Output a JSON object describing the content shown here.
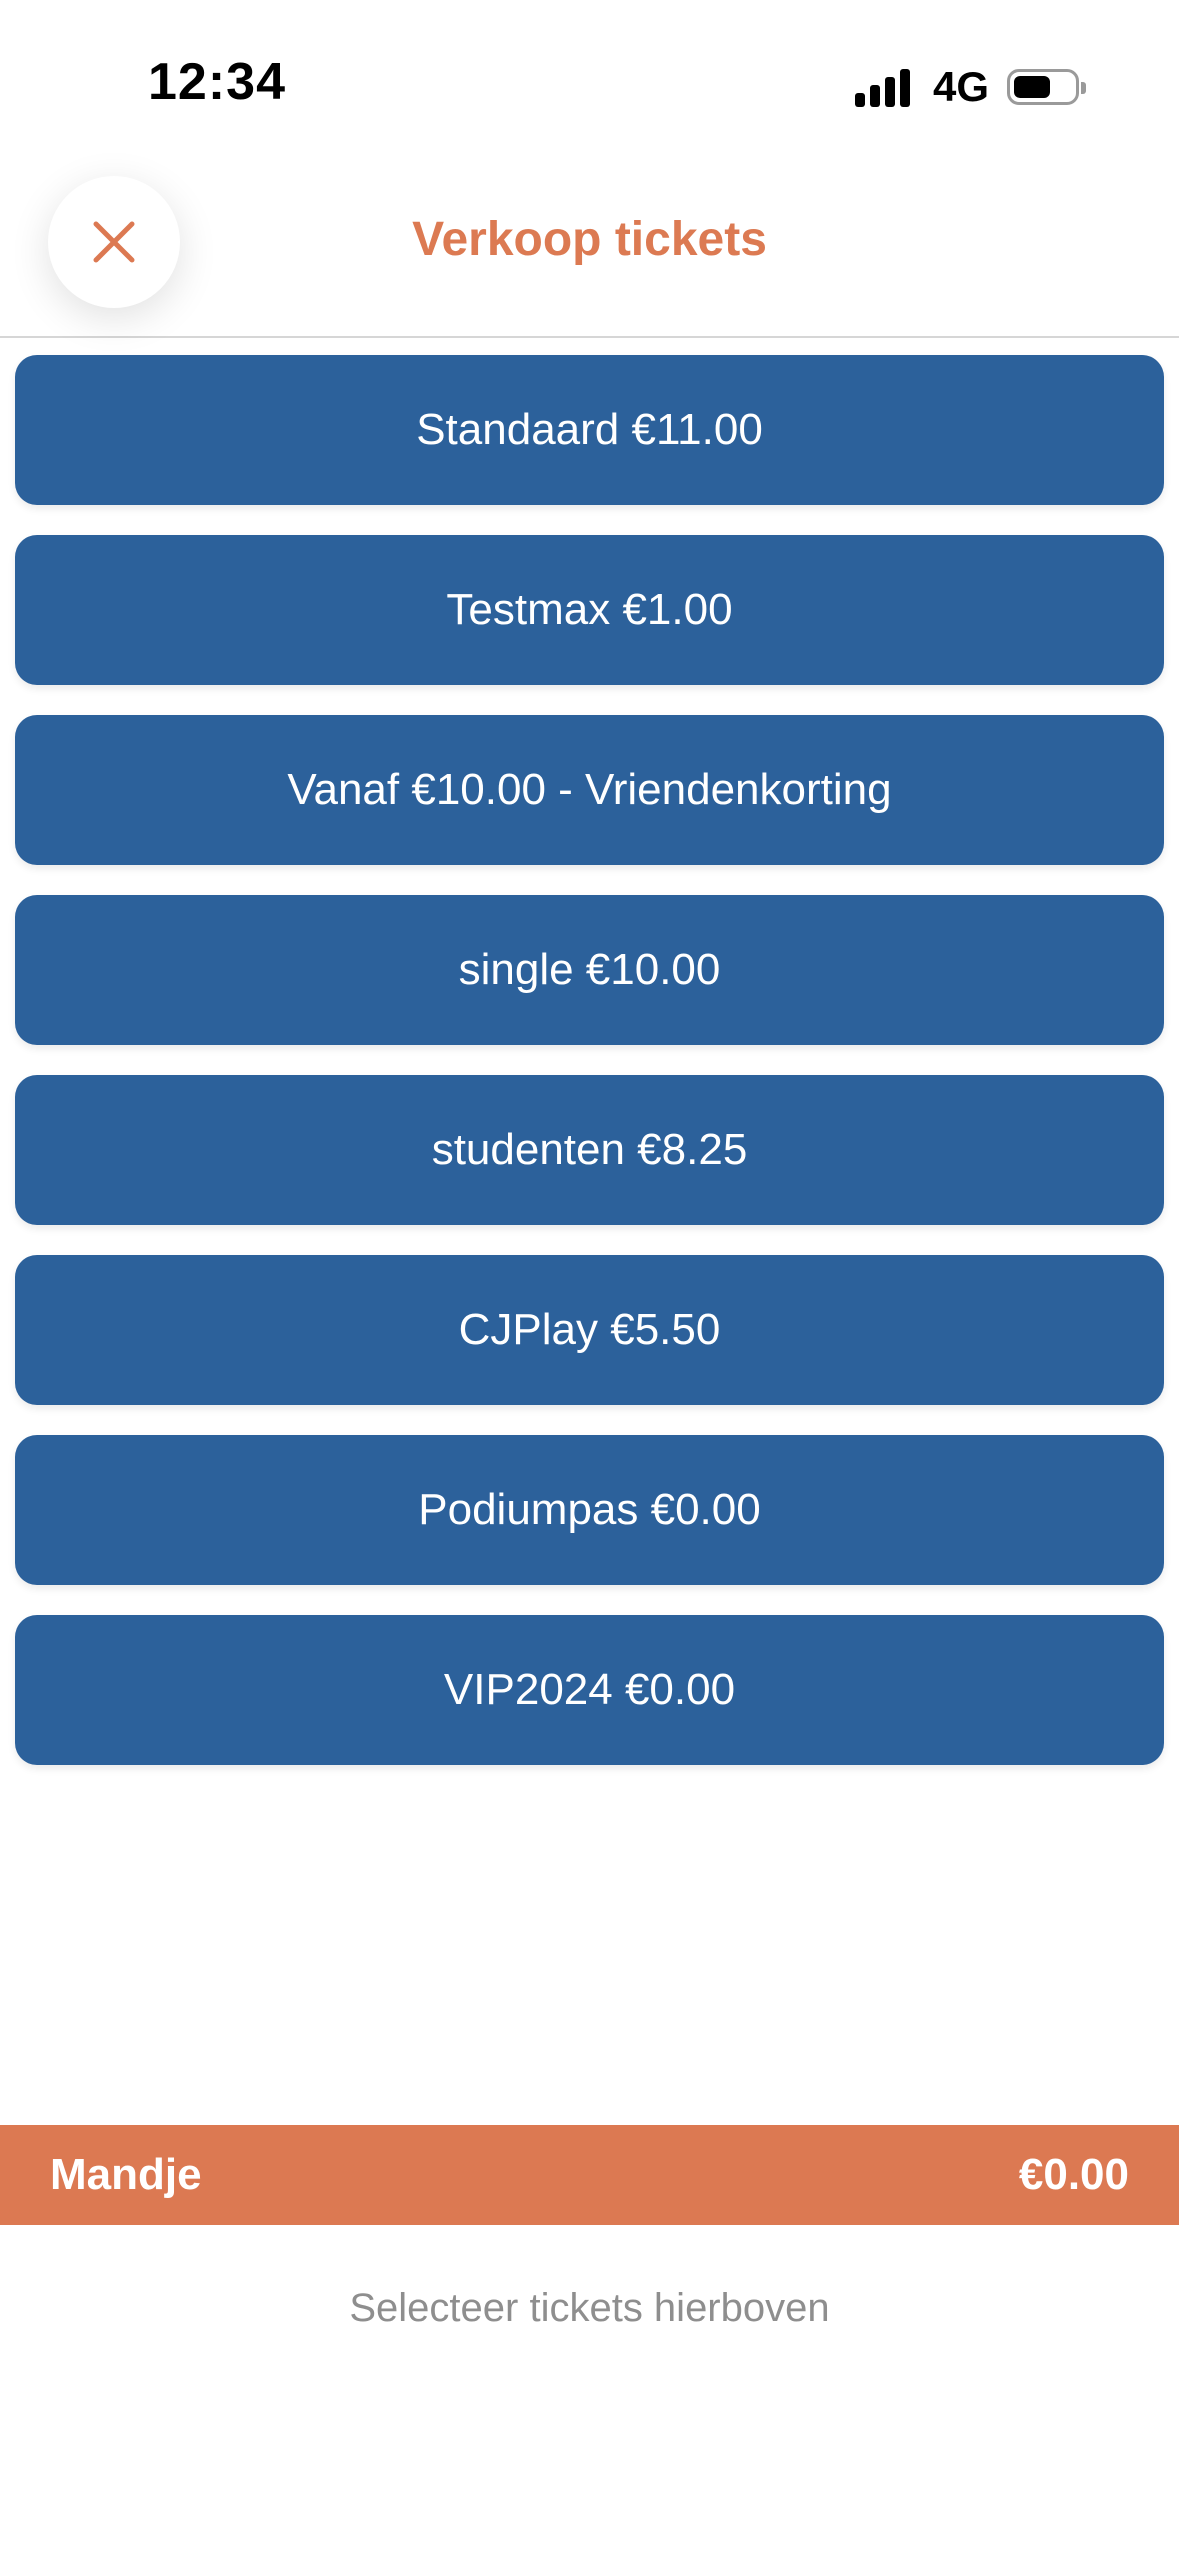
{
  "status_bar": {
    "time": "12:34",
    "network": "4G",
    "icons": [
      "signal-icon",
      "battery-icon"
    ]
  },
  "header": {
    "title": "Verkoop tickets",
    "close_icon": "close-icon"
  },
  "tickets": [
    {
      "label": "Standaard €11.00"
    },
    {
      "label": "Testmax €1.00"
    },
    {
      "label": "Vanaf €10.00 - Vriendenkorting"
    },
    {
      "label": "single €10.00"
    },
    {
      "label": "studenten €8.25"
    },
    {
      "label": "CJPlay €5.50"
    },
    {
      "label": "Podiumpas €0.00"
    },
    {
      "label": "VIP2024 €0.00"
    }
  ],
  "basket": {
    "label": "Mandje",
    "total": "€0.00",
    "hint": "Selecteer tickets hierboven"
  },
  "colors": {
    "accent": "#dc7952",
    "ticket_button": "#2c619b",
    "hint_text": "#8e8e8e"
  }
}
